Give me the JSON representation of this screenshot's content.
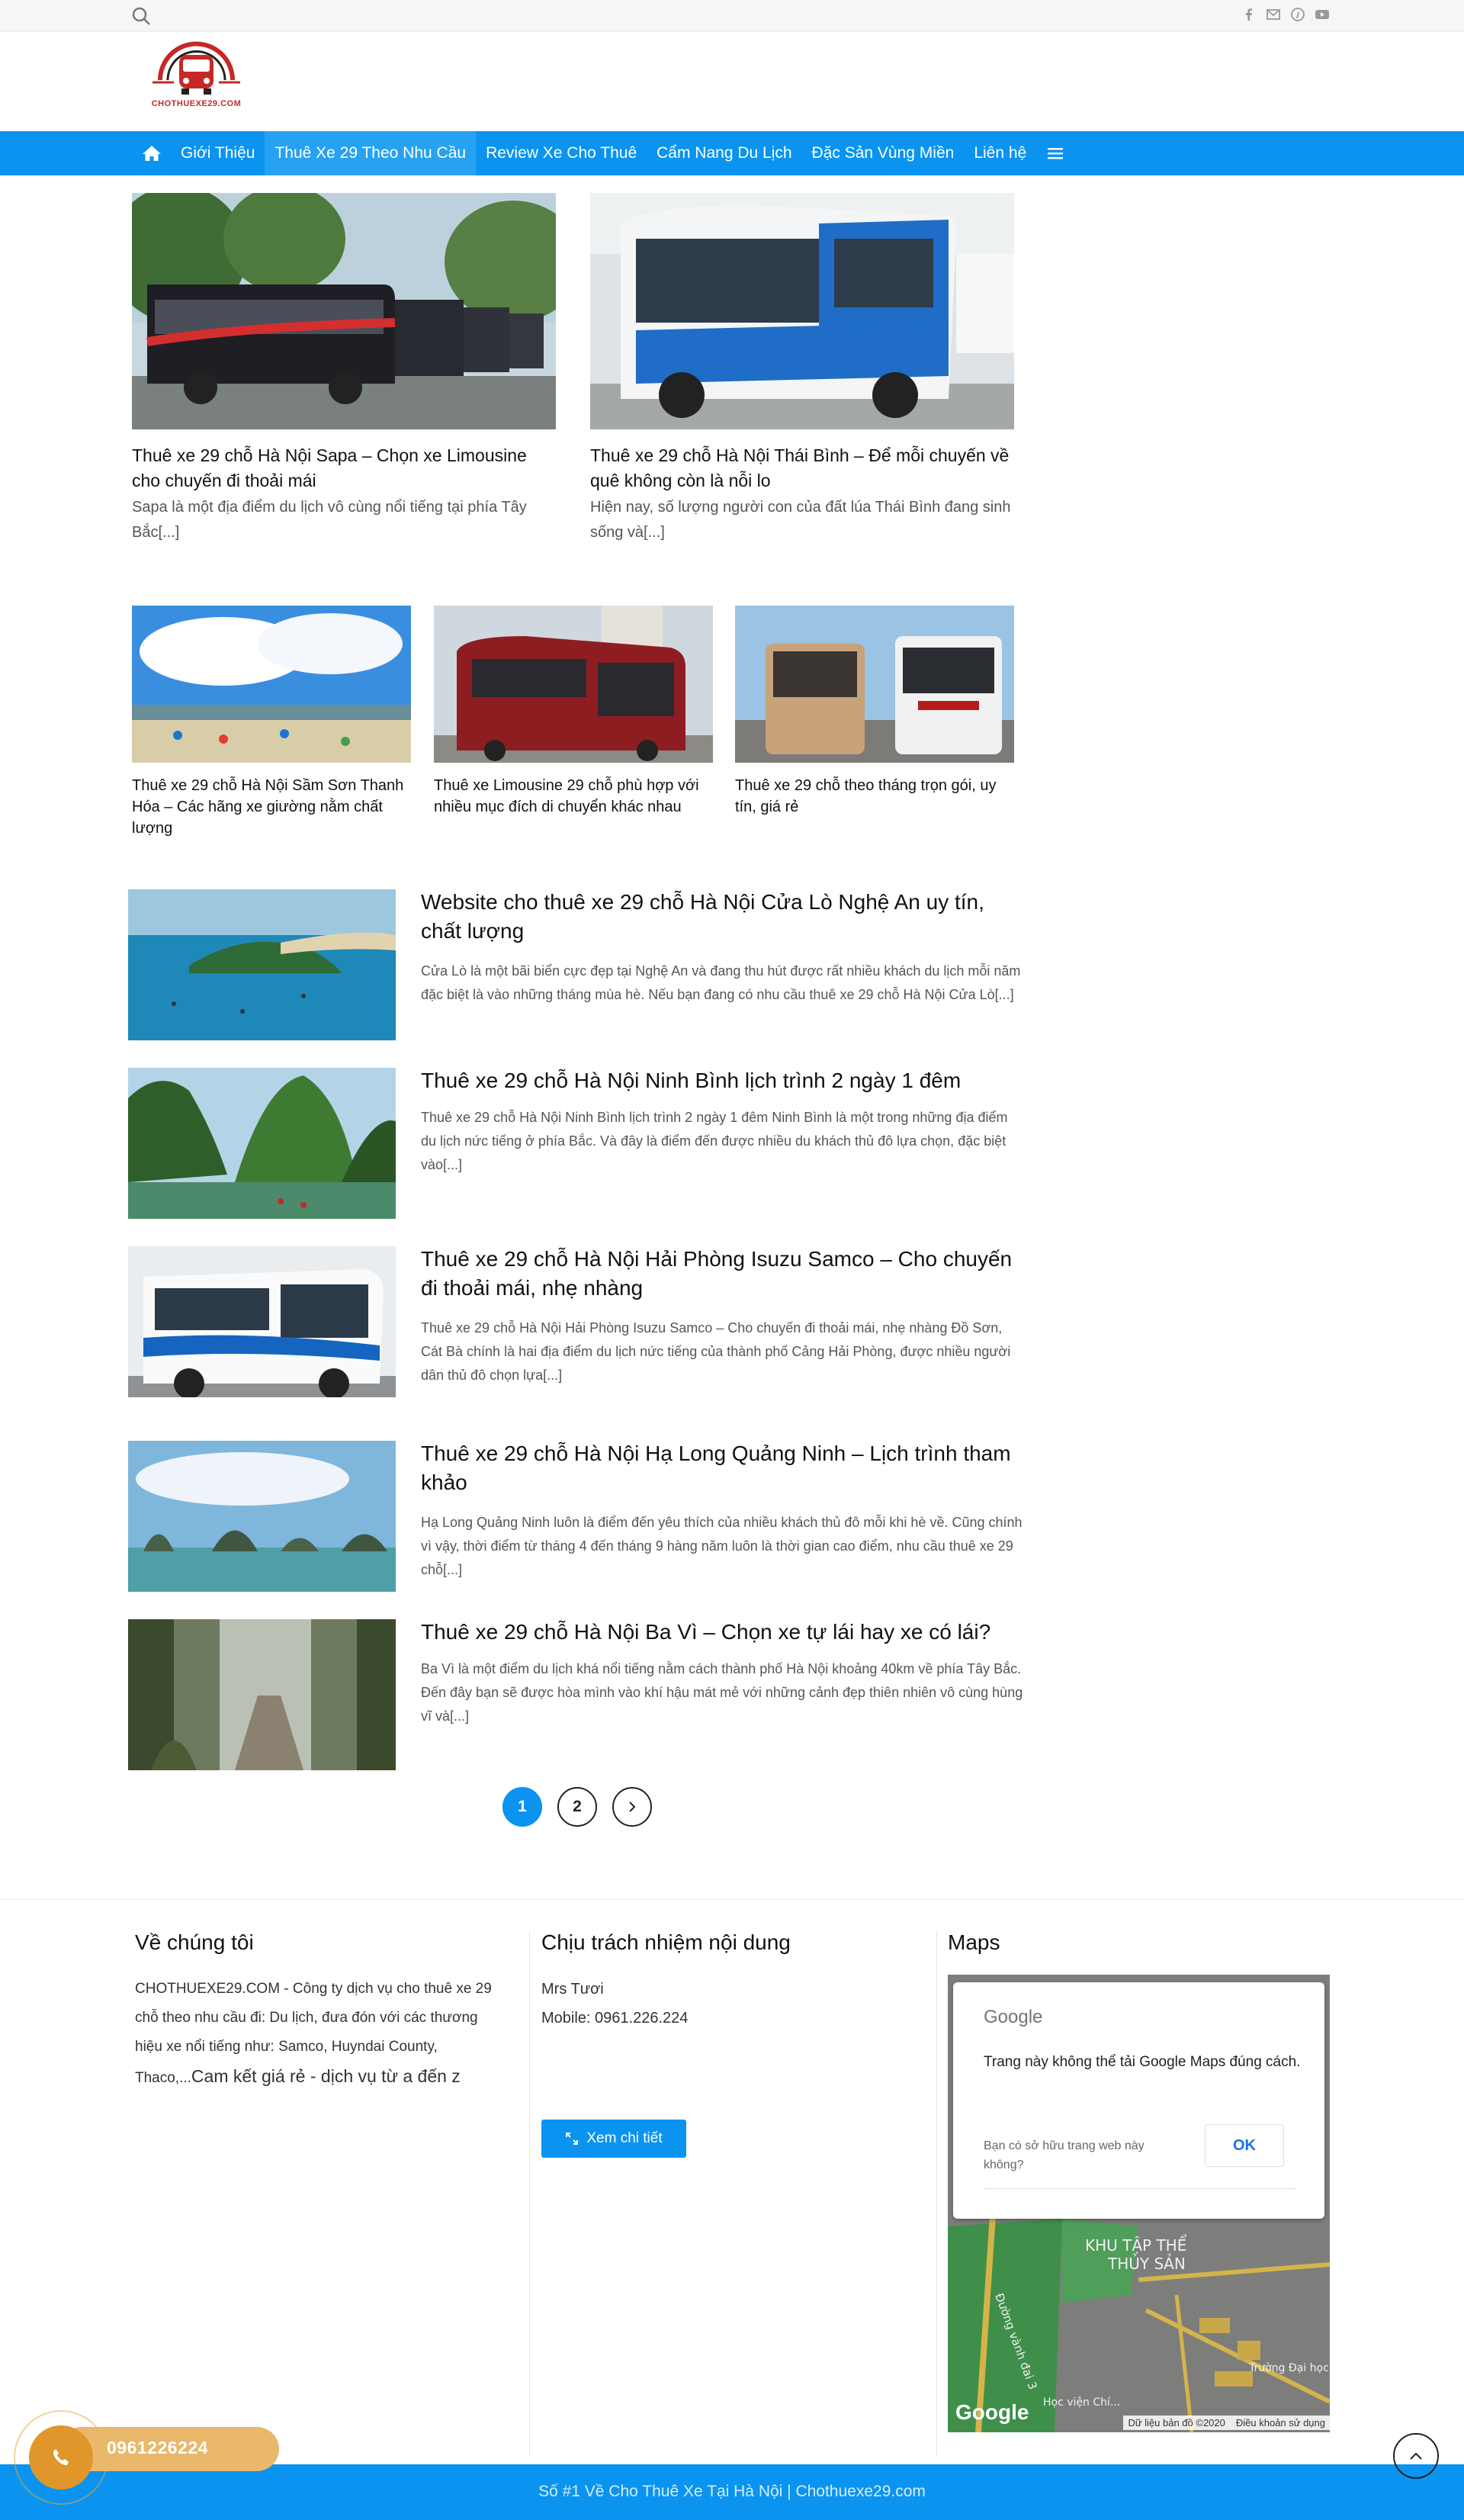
{
  "topbar": {
    "search_icon": "search-icon",
    "social_icons": [
      "facebook-icon",
      "email-icon",
      "pinterest-icon",
      "youtube-icon"
    ]
  },
  "header": {
    "logo_text": "CHOTHUEXE29.COM"
  },
  "nav": {
    "items": [
      {
        "label": "Giới Thiệu"
      },
      {
        "label": "Thuê Xe 29 Theo Nhu Cầu"
      },
      {
        "label": "Review Xe Cho Thuê"
      },
      {
        "label": "Cẩm Nang Du Lịch"
      },
      {
        "label": "Đặc Sản Vùng Miền"
      },
      {
        "label": "Liên hệ"
      }
    ]
  },
  "featured": [
    {
      "title": "Thuê xe 29 chỗ Hà Nội Sapa – Chọn xe Limousine cho chuyến đi thoải mái",
      "excerpt": "Sapa là một địa điểm du lịch vô cùng nổi tiếng tại phía Tây Bắc[...]"
    },
    {
      "title": "Thuê xe 29 chỗ Hà Nội Thái Bình – Để mỗi chuyến về quê không còn là nỗi lo",
      "excerpt": "Hiện nay, số lượng người con của đất lúa Thái Bình đang sinh sống và[...]"
    }
  ],
  "small_cards": [
    {
      "title": "Thuê xe 29 chỗ Hà Nội Sầm Sơn Thanh Hóa – Các hãng xe giường nằm chất lượng"
    },
    {
      "title": "Thuê xe Limousine 29 chỗ phù hợp với nhiều mục đích di chuyển khác nhau"
    },
    {
      "title": "Thuê xe 29 chỗ theo tháng trọn gói, uy tín, giá rẻ"
    }
  ],
  "posts": [
    {
      "title": "Website cho thuê xe 29 chỗ Hà Nội Cửa Lò Nghệ An uy tín, chất lượng",
      "excerpt": "Cửa Lò là một bãi biển cực đẹp tại Nghệ An và đang thu hút được rất nhiều khách du lịch mỗi năm đặc biệt là vào những tháng mùa hè. Nếu bạn đang có nhu cầu thuê xe 29 chỗ Hà Nội Cửa Lò[...]"
    },
    {
      "title": "Thuê xe 29 chỗ Hà Nội Ninh Bình lịch trình 2 ngày 1 đêm",
      "excerpt": "Thuê xe 29 chỗ Hà Nội Ninh Bình lịch trình 2 ngày 1 đêm Ninh Bình là một trong những địa điểm du lịch nức tiếng ở phía Bắc. Và đây là điểm đến được nhiều du khách thủ đô lựa chọn, đặc biệt vào[...]"
    },
    {
      "title": "Thuê xe 29 chỗ Hà Nội Hải Phòng Isuzu Samco – Cho chuyến đi thoải mái, nhẹ nhàng",
      "excerpt": "Thuê xe 29 chỗ Hà Nội Hải Phòng Isuzu Samco – Cho chuyến đi thoải mái, nhẹ nhàng Đồ Sơn, Cát Bà chính là hai địa điểm du lịch nức tiếng của thành phố Cảng Hải Phòng, được nhiều người dân thủ đô chọn lựa[...]"
    },
    {
      "title": "Thuê xe 29 chỗ Hà Nội Hạ Long Quảng Ninh – Lịch trình tham khảo",
      "excerpt": "Hạ Long Quảng Ninh luôn là điểm đến yêu thích của nhiều khách thủ đô mỗi khi hè về. Cũng chính vì vậy, thời điểm từ tháng 4 đến tháng 9 hàng năm luôn là thời gian cao điểm, nhu cầu thuê xe 29 chỗ[...]"
    },
    {
      "title": "Thuê xe 29 chỗ Hà Nội Ba Vì – Chọn xe tự lái hay xe có lái?",
      "excerpt": "Ba Vì là một điểm du lịch khá nổi tiếng nằm cách thành phố Hà Nội khoảng 40km về phía Tây Bắc. Đến đây bạn sẽ được hòa mình vào khí hậu mát mẻ với những cảnh đẹp thiên nhiên vô cùng hùng vĩ và[...]"
    }
  ],
  "pagination": {
    "current": "1",
    "next": "2"
  },
  "footer": {
    "about_title": "Về chúng tôi",
    "about_text": "CHOTHUEXE29.COM - Công ty dịch vụ cho thuê xe 29 chỗ theo nhu cầu đi: Du lịch, đưa đón với các thương hiệu xe nổi tiếng như: Samco, Huyndai County, Thaco,...",
    "about_text_big": "Cam kết giá rẻ - dịch vụ từ a đến z",
    "resp_title": "Chịu trách nhiệm nội dung",
    "resp_name": "Mrs Tươi",
    "resp_mobile": "Mobile: 0961.226.224",
    "more_button": "Xem chi tiết",
    "maps_title": "Maps",
    "map": {
      "google_label": "Google",
      "message": "Trang này không thể tải Google Maps đúng cách.",
      "owner_question": "Bạn có sở hữu trang web này không?",
      "ok": "OK",
      "map_labels": [
        "KHU TẬP THỂ",
        "THỦY SẢN",
        "Đường vành đai 3",
        "Trường Đại học Khoa học Tự nhiên, Đ...",
        "Học viện Chí..."
      ],
      "attribution": [
        "Dữ liệu bản đồ ©2020",
        "Điều khoản sử dụng"
      ]
    },
    "copyright": "Số #1 Về Cho Thuê Xe Tại Hà Nội | Chothuexe29.com"
  },
  "call_button": {
    "number": "0961226224"
  },
  "colors": {
    "primary": "#0a94f0",
    "call": "#e0962a",
    "logo_red": "#c62828"
  }
}
